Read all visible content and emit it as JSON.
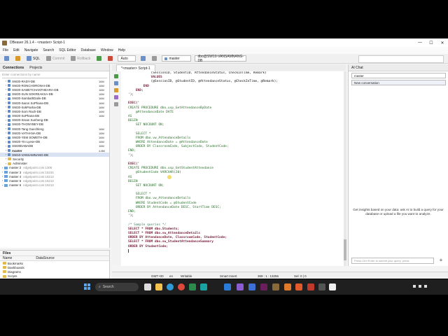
{
  "window": {
    "title": "DBeaver 26.1.4 - <master> Script-1",
    "controls": [
      "—",
      "☐",
      "✕"
    ]
  },
  "menu": [
    "File",
    "Edit",
    "Navigate",
    "Search",
    "SQL Editor",
    "Database",
    "Window",
    "Help"
  ],
  "toolbar": {
    "sql_label": "SQL",
    "commit_label": "Commit",
    "rollback_label": "Rollback",
    "txn_mode": "Auto",
    "connection": "master",
    "datasource": "dbo@SW10-VANSAMNANG-DB"
  },
  "navigator": {
    "tabs": [
      "Connections",
      "Projects"
    ],
    "filter_placeholder": "Enter connections by name",
    "items": [
      {
        "label": "SW20-RADY-DB",
        "size": "16M",
        "type": "db"
      },
      {
        "label": "SW20-RONCHORONAI-DB",
        "size": "16M",
        "type": "db"
      },
      {
        "label": "SW20-SAMETCHANTHEARA-DB",
        "size": "16M",
        "type": "db"
      },
      {
        "label": "SW20-SUN SOKREAKSA-DB",
        "size": "16M",
        "type": "db"
      },
      {
        "label": "SW20-SambathDalin-DB",
        "size": "16M",
        "type": "db"
      },
      {
        "label": "SW20-Saron SoPhana-DB",
        "size": "16M",
        "type": "db"
      },
      {
        "label": "SW20-SokPanha-DB",
        "size": "16M",
        "type": "db"
      },
      {
        "label": "SW20-Sorn Rach-DB",
        "size": "16M",
        "type": "db"
      },
      {
        "label": "SW20-SoPhana-DB",
        "size": "16M",
        "type": "db"
      },
      {
        "label": "SW20-Srean Sunheng-DB",
        "size": "",
        "type": "db"
      },
      {
        "label": "SW20-THONYBEY-DB",
        "size": "",
        "type": "db"
      },
      {
        "label": "SW20-Tang Guechleng",
        "size": "16M",
        "type": "db"
      },
      {
        "label": "SW20-VATHANA-DB",
        "size": "16M",
        "type": "db"
      },
      {
        "label": "SW20-YEM SOMETH-DB",
        "size": "16M",
        "type": "db"
      },
      {
        "label": "SW20-Yin Lyese-DB",
        "size": "16M",
        "type": "db"
      },
      {
        "label": "SW20DABADB",
        "size": "16M",
        "type": "db"
      },
      {
        "label": "master",
        "size": "4.8M",
        "type": "db",
        "bold": true
      },
      {
        "label": "SW10-VANSAMNANG-DB",
        "size": "",
        "type": "db",
        "selected": true
      }
    ],
    "tail": [
      {
        "label": "Security",
        "host": "",
        "type": "folder",
        "indent": 1
      },
      {
        "label": "Administer",
        "host": "",
        "type": "folder",
        "indent": 1
      },
      {
        "label": "master 2",
        "host": "edgetpoint.com:1306",
        "type": "conn",
        "indent": 0
      },
      {
        "label": "master 3",
        "host": "edgetpoint.com:15234",
        "type": "conn",
        "indent": 0
      },
      {
        "label": "master 4",
        "host": "edgetpoint.com:15213",
        "type": "conn",
        "indent": 0
      },
      {
        "label": "master 5",
        "host": "edgetpoint.com:15213",
        "type": "conn",
        "indent": 0
      },
      {
        "label": "master 6",
        "host": "edgetpoint.com:15213",
        "type": "conn",
        "indent": 0
      }
    ]
  },
  "projects": {
    "tab_label": "Files",
    "columns": [
      "Name",
      "DataSource"
    ],
    "items": [
      "Bookmarks",
      "Dashboards",
      "Diagrams",
      "Scripts"
    ]
  },
  "editor": {
    "tab_label": "*<master> Script-1",
    "lines": [
      [
        {
          "t": "            (SessionID, StudentID, AttendanceStatus, CheckInTime, Remark)",
          "c": ""
        }
      ],
      [
        {
          "t": "            VALUES",
          "c": "kw"
        }
      ],
      [
        {
          "t": "            (@SessionID, @StudentID, @AttendanceStatus, @CheckInTime, @Remark);",
          "c": ""
        }
      ],
      [
        {
          "t": "        END",
          "c": "kw"
        }
      ],
      [
        {
          "t": "    END;",
          "c": "kw"
        }
      ],
      [
        {
          "t": "');",
          "c": ""
        }
      ],
      [
        {
          "t": "",
          "c": ""
        }
      ],
      [
        {
          "t": "EXEC('",
          "c": "kw"
        }
      ],
      [
        {
          "t": "CREATE PROCEDURE dbo.usp_GetAttendanceByDate",
          "c": "lm"
        }
      ],
      [
        {
          "t": "    @AttendanceDate DATE",
          "c": "lm"
        }
      ],
      [
        {
          "t": "AS",
          "c": "lm"
        }
      ],
      [
        {
          "t": "BEGIN",
          "c": "lm"
        }
      ],
      [
        {
          "t": "    SET NOCOUNT ON;",
          "c": "lm"
        }
      ],
      [
        {
          "t": "",
          "c": ""
        }
      ],
      [
        {
          "t": "    SELECT *",
          "c": "lm"
        }
      ],
      [
        {
          "t": "    FROM dbo.vw_AttendanceDetails",
          "c": "lm"
        }
      ],
      [
        {
          "t": "    WHERE AttendanceDate = @AttendanceDate",
          "c": "lm"
        }
      ],
      [
        {
          "t": "    ORDER BY ClassroomCode, SubjectCode, StudentCode;",
          "c": "lm"
        }
      ],
      [
        {
          "t": "END;",
          "c": "lm"
        }
      ],
      [
        {
          "t": "');",
          "c": ""
        }
      ],
      [
        {
          "t": "",
          "c": ""
        }
      ],
      [
        {
          "t": "EXEC('",
          "c": "kw"
        }
      ],
      [
        {
          "t": "CREATE PROCEDURE dbo.usp_GetStudentAttendance",
          "c": "lm"
        }
      ],
      [
        {
          "t": "    @StudentCode VARCHAR(20)",
          "c": "lm"
        }
      ],
      [
        {
          "t": "AS",
          "c": "lm"
        }
      ],
      [
        {
          "t": "BEGIN",
          "c": "lm"
        }
      ],
      [
        {
          "t": "    SET NOCOUNT ON;",
          "c": "lm"
        }
      ],
      [
        {
          "t": "",
          "c": ""
        }
      ],
      [
        {
          "t": "    SELECT *",
          "c": "lm"
        }
      ],
      [
        {
          "t": "    FROM dbo.vw_AttendanceDetails",
          "c": "lm"
        }
      ],
      [
        {
          "t": "    WHERE StudentCode = @StudentCode",
          "c": "lm"
        }
      ],
      [
        {
          "t": "    ORDER BY AttendanceDate DESC, StartTime DESC;",
          "c": "lm"
        }
      ],
      [
        {
          "t": "END;",
          "c": "lm"
        }
      ],
      [
        {
          "t": "');",
          "c": ""
        }
      ],
      [
        {
          "t": "",
          "c": ""
        }
      ],
      [
        {
          "t": "/* Sample queries */",
          "c": "cm"
        }
      ],
      [
        {
          "t": "SELECT * FROM dbo.Students;",
          "c": "kw"
        }
      ],
      [
        {
          "t": "SELECT * FROM dbo.vw_AttendanceDetails",
          "c": "kw"
        }
      ],
      [
        {
          "t": "ORDER BY AttendanceDate, ClassroomCode, StudentCode;",
          "c": "kw"
        }
      ],
      [
        {
          "t": "SELECT * FROM dbo.vw_StudentAttendanceSummary",
          "c": "kw"
        }
      ],
      [
        {
          "t": "ORDER BY StudentCode;",
          "c": "kw"
        }
      ],
      [
        {
          "t": "",
          "c": "caret"
        }
      ]
    ]
  },
  "ai": {
    "tab_label": "AI Chat",
    "connection": "master",
    "conversation": "New conversation",
    "hint": "Get insights based on your data: ask AI to build a query for your database or upload a file you want to analyze.",
    "input_placeholder": "Press Ctrl+Enter to submit your query, press",
    "send": "+"
  },
  "status": {
    "tz": "GMT+00",
    "lang": "en",
    "mode": "Writable",
    "insert": "Smart Insert",
    "pos": "369 : 1 : 13256",
    "sel": "Sel: 0 | 0"
  },
  "taskbar": {
    "search_label": "Search"
  },
  "colors": {
    "accent": "#5c8bc9",
    "selection": "#d9e3f3",
    "taskbar": "#1f1f1f"
  }
}
